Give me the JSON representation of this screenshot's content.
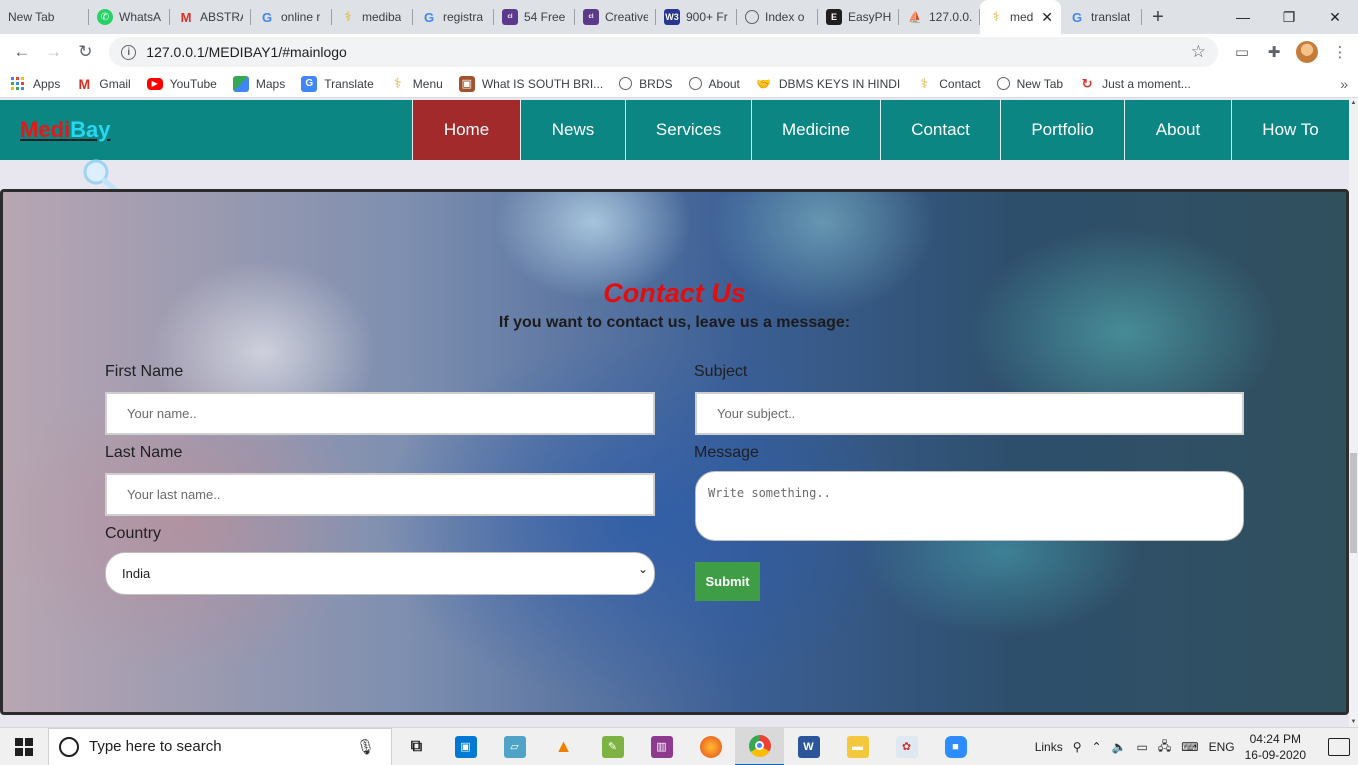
{
  "browser": {
    "tabs": [
      {
        "label": "New Tab",
        "icon": "none",
        "color": ""
      },
      {
        "label": "WhatsA",
        "icon": "whatsapp-icon",
        "color": "#25d366"
      },
      {
        "label": "ABSTRA",
        "icon": "gmail-icon",
        "color": "#d93025"
      },
      {
        "label": "online r",
        "icon": "google-icon",
        "color": "#4285f4"
      },
      {
        "label": "mediba",
        "icon": "medibay-icon",
        "color": "#e0b040"
      },
      {
        "label": "registra",
        "icon": "google-icon",
        "color": "#4285f4"
      },
      {
        "label": "54 Free",
        "icon": "colorlib-icon",
        "color": "#5b3a8c"
      },
      {
        "label": "Creative",
        "icon": "colorlib-icon",
        "color": "#5b3a8c"
      },
      {
        "label": "900+ Fr",
        "icon": "w3-icon",
        "color": "#283593"
      },
      {
        "label": "Index o",
        "icon": "globe-icon",
        "color": "#5f6368"
      },
      {
        "label": "EasyPH",
        "icon": "easyphp-icon",
        "color": "#1f1f1f"
      },
      {
        "label": "127.0.0.",
        "icon": "phpmyadmin-icon",
        "color": "#f29b1d"
      },
      {
        "label": "med",
        "icon": "medibay-icon",
        "color": "#e0b040",
        "active": true
      },
      {
        "label": "translat",
        "icon": "google-icon",
        "color": "#4285f4"
      }
    ],
    "url": "127.0.0.1/MEDIBAY1/#mainlogo",
    "bookmarks": [
      {
        "label": "Apps",
        "icon": "apps-grid-icon"
      },
      {
        "label": "Gmail",
        "icon": "gmail-icon"
      },
      {
        "label": "YouTube",
        "icon": "youtube-icon"
      },
      {
        "label": "Maps",
        "icon": "maps-icon"
      },
      {
        "label": "Translate",
        "icon": "translate-icon"
      },
      {
        "label": "Menu",
        "icon": "medibay-icon"
      },
      {
        "label": "What IS SOUTH BRI...",
        "icon": "image-icon"
      },
      {
        "label": "BRDS",
        "icon": "globe-icon"
      },
      {
        "label": "About",
        "icon": "globe-icon"
      },
      {
        "label": "DBMS KEYS IN HINDI",
        "icon": "handshake-icon"
      },
      {
        "label": "Contact",
        "icon": "medibay-icon"
      },
      {
        "label": "New Tab",
        "icon": "globe-icon"
      },
      {
        "label": "Just a moment...",
        "icon": "spinner-icon"
      }
    ]
  },
  "site": {
    "logo_part1": "Medi",
    "logo_part2": "Bay",
    "nav": [
      {
        "label": "Home",
        "active": true
      },
      {
        "label": "News"
      },
      {
        "label": "Services"
      },
      {
        "label": "Medicine"
      },
      {
        "label": "Contact"
      },
      {
        "label": "Portfolio"
      },
      {
        "label": "About"
      },
      {
        "label": "How To"
      }
    ],
    "contact": {
      "title": "Contact Us",
      "subtitle": "If you want to contact us, leave us a message:",
      "first_name_label": "First Name",
      "first_name_placeholder": "Your name..",
      "last_name_label": "Last Name",
      "last_name_placeholder": "Your last name..",
      "country_label": "Country",
      "country_value": "India",
      "subject_label": "Subject",
      "subject_placeholder": "Your subject..",
      "message_label": "Message",
      "message_placeholder": "Write something..",
      "submit_label": "Submit"
    }
  },
  "taskbar": {
    "search_placeholder": "Type here to search",
    "links_label": "Links",
    "language": "ENG",
    "time": "04:24 PM",
    "date": "16-09-2020"
  },
  "colors": {
    "nav_bg": "#0b8682",
    "nav_active": "#a22a2a",
    "title_red": "#e30d0d",
    "submit_green": "#3f9e45"
  }
}
